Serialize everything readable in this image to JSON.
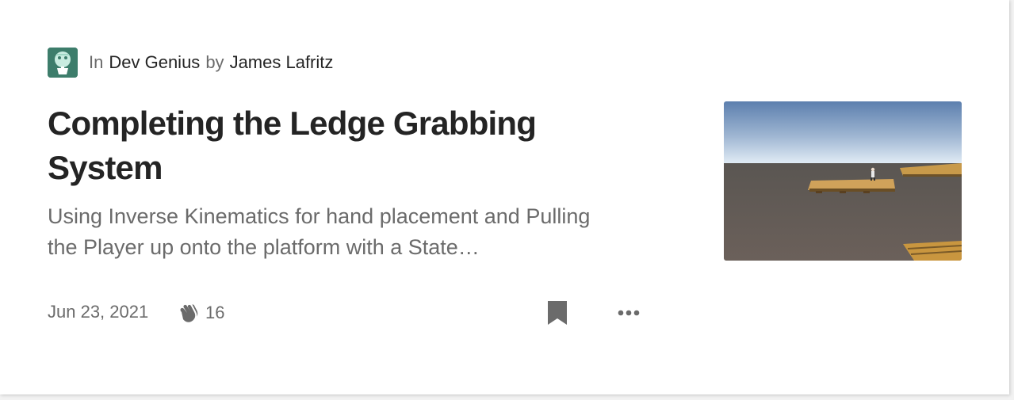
{
  "post": {
    "publication_prefix": "In",
    "publication_name": "Dev Genius",
    "author_prefix": "by",
    "author_name": "James Lafritz",
    "title": "Completing the Ledge Grabbing System",
    "subtitle": "Using Inverse Kinematics for hand placement and Pulling the Player up onto the platform with a State…",
    "date": "Jun 23, 2021",
    "claps": "16"
  },
  "icons": {
    "publication_logo": "dev-genius-logo",
    "clap": "clap-icon",
    "bookmark": "bookmark-icon",
    "more": "more-icon"
  },
  "colors": {
    "text_primary": "#242424",
    "text_secondary": "#6b6b6b",
    "publication_logo_bg": "#3d7d6b"
  }
}
